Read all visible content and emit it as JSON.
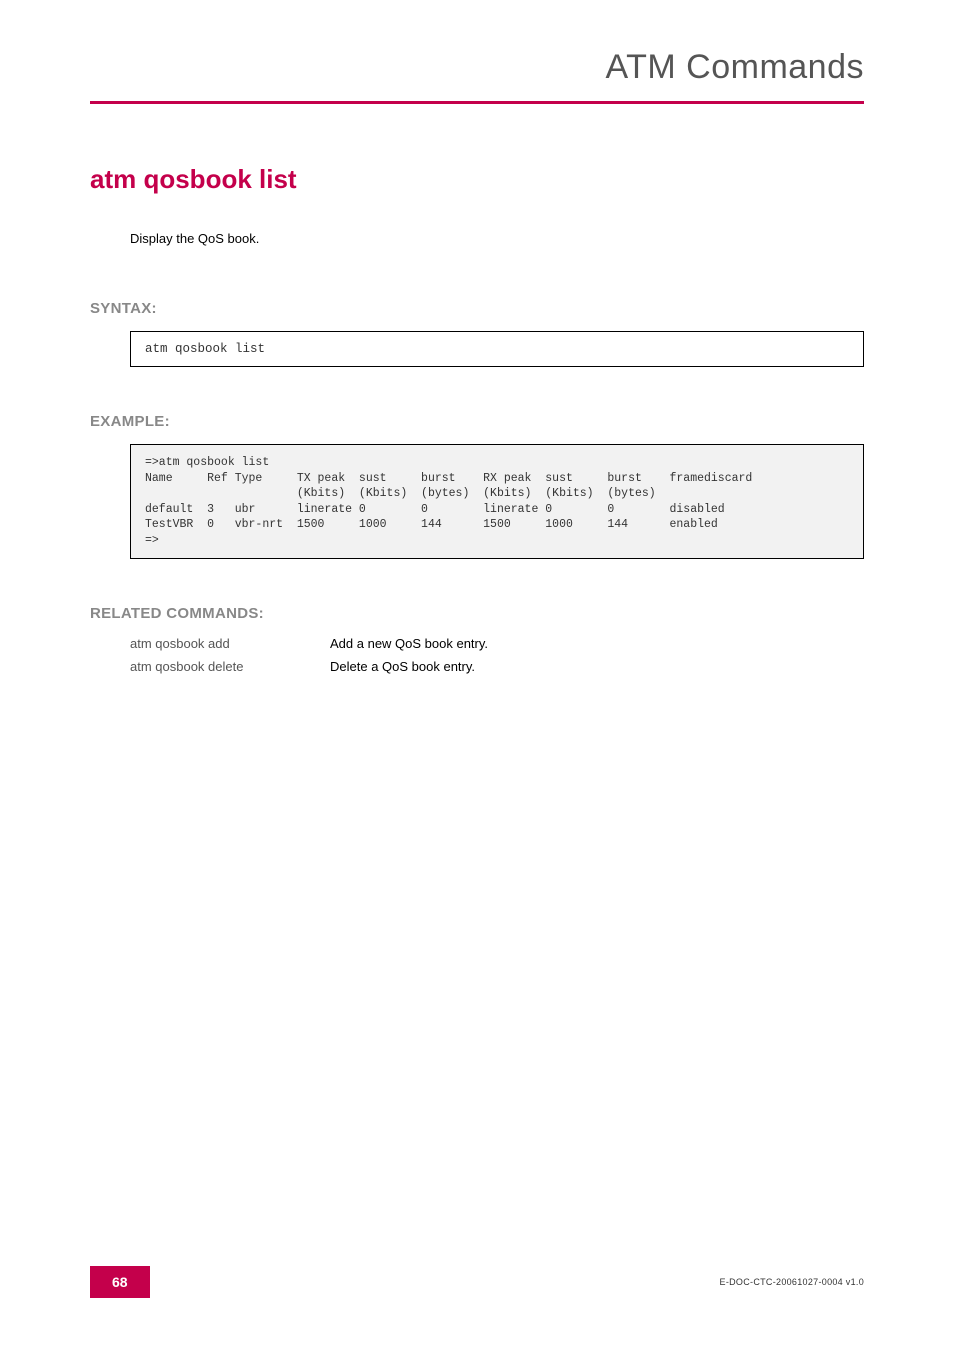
{
  "header": {
    "title": "ATM Commands"
  },
  "command": {
    "title": "atm qosbook list",
    "intro": "Display the QoS book."
  },
  "syntax": {
    "label": "SYNTAX:",
    "code": "atm qosbook list"
  },
  "example": {
    "label": "EXAMPLE:",
    "code": "=>atm qosbook list\nName     Ref Type     TX peak  sust     burst    RX peak  sust     burst    framediscard\n                      (Kbits)  (Kbits)  (bytes)  (Kbits)  (Kbits)  (bytes)\ndefault  3   ubr      linerate 0        0        linerate 0        0        disabled\nTestVBR  0   vbr-nrt  1500     1000     144      1500     1000     144      enabled\n=>"
  },
  "related": {
    "label": "RELATED COMMANDS:",
    "rows": [
      {
        "cmd": "atm qosbook add",
        "desc": "Add a new QoS book entry."
      },
      {
        "cmd": "atm qosbook delete",
        "desc": "Delete a QoS book entry."
      }
    ]
  },
  "footer": {
    "page": "68",
    "docid": "E-DOC-CTC-20061027-0004 v1.0"
  },
  "chart_data": {
    "type": "table",
    "title": "atm qosbook list output",
    "columns": [
      "Name",
      "Ref",
      "Type",
      "TX peak (Kbits)",
      "sust (Kbits)",
      "burst (bytes)",
      "RX peak (Kbits)",
      "sust (Kbits)",
      "burst (bytes)",
      "framediscard"
    ],
    "rows": [
      [
        "default",
        3,
        "ubr",
        "linerate",
        0,
        0,
        "linerate",
        0,
        0,
        "disabled"
      ],
      [
        "TestVBR",
        0,
        "vbr-nrt",
        1500,
        1000,
        144,
        1500,
        1000,
        144,
        "enabled"
      ]
    ]
  }
}
